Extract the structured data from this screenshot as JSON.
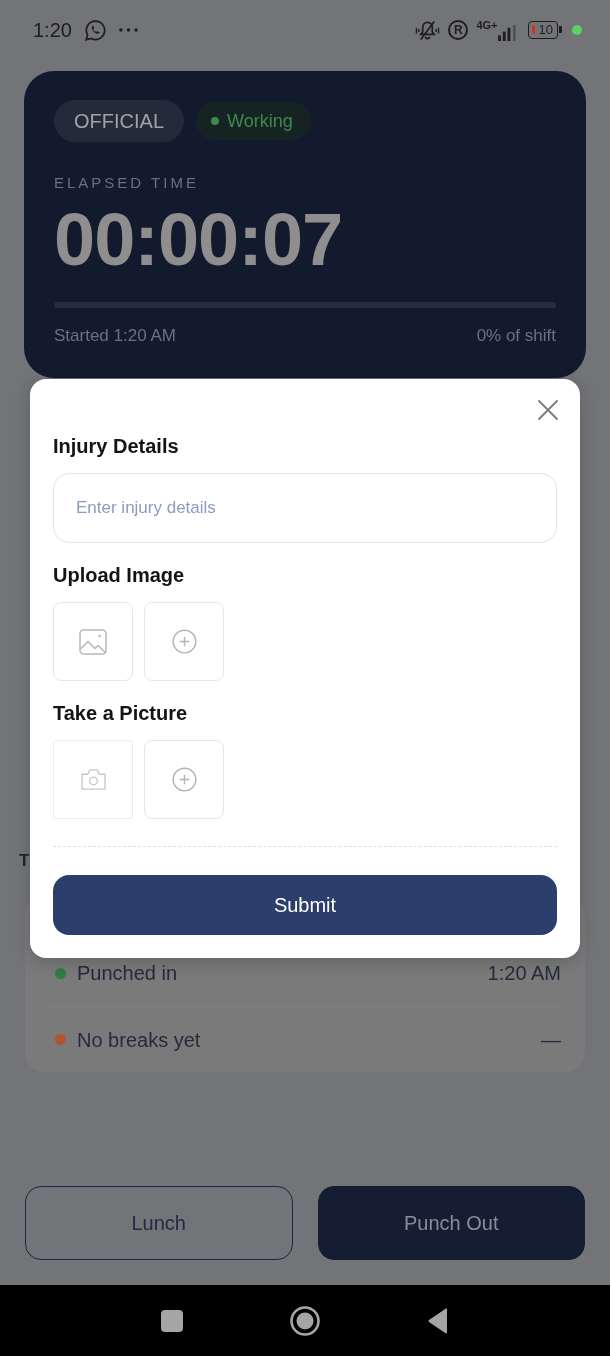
{
  "status_bar": {
    "time": "1:20",
    "roaming": "R",
    "network": "4G+",
    "battery": "10"
  },
  "shift_card": {
    "tags": [
      {
        "kind": "plain",
        "label": "OFFICIAL"
      },
      {
        "kind": "status",
        "label": "Working",
        "color": "#3d8a4f"
      }
    ],
    "caption": "ELAPSED TIME",
    "elapsed": "00:00:07",
    "progress": {
      "level": 0
    },
    "started": "Started 1:20 AM",
    "share": "0% of shift"
  },
  "activity": {
    "title": "T",
    "events": [
      {
        "label": "Punched in",
        "time": "1:20 AM",
        "color": "#2e7d46"
      },
      {
        "label": "No breaks yet",
        "time": "—",
        "color": "#b2552e"
      }
    ]
  },
  "actions": [
    {
      "kind": "outline",
      "label": "Lunch"
    },
    {
      "kind": "solid",
      "label": "Punch Out"
    }
  ],
  "dialog": {
    "sections": [
      {
        "kind": "text",
        "title": "Injury Details",
        "placeholder": "Enter injury details"
      },
      {
        "kind": "gallery",
        "title": "Upload Image"
      },
      {
        "kind": "camera",
        "title": "Take a Picture"
      }
    ],
    "submit": "Submit"
  }
}
